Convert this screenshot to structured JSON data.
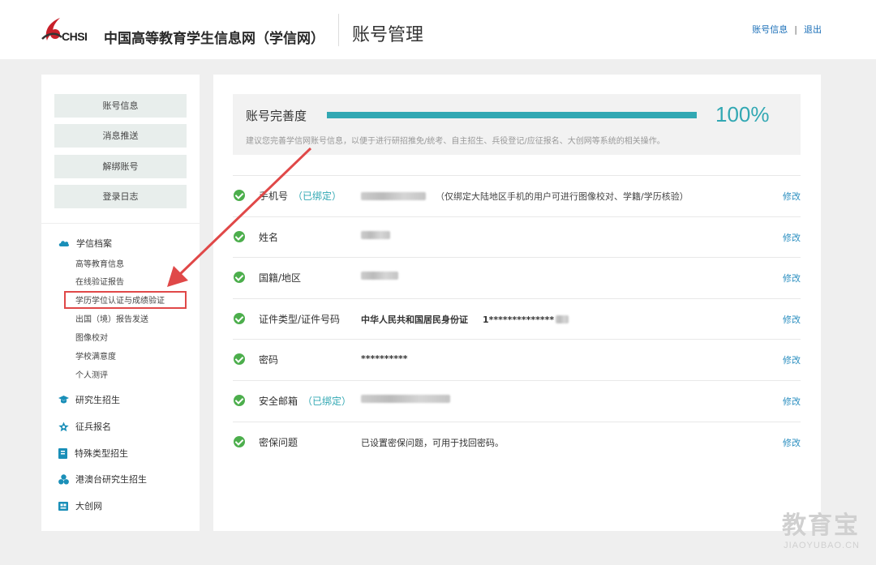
{
  "header": {
    "logo_text": "CHSI",
    "site_name": "中国高等教育学生信息网（学信网）",
    "page_title": "账号管理",
    "links": [
      "账号信息",
      "退出"
    ],
    "link_separator": "|"
  },
  "sidebar": {
    "buttons": [
      "账号信息",
      "消息推送",
      "解绑账号",
      "登录日志"
    ],
    "sections": [
      {
        "title": "学信档案",
        "icon": "cloud-icon",
        "items": [
          "高等教育信息",
          "在线验证报告",
          "学历学位认证与成绩验证",
          "出国（境）报告发送",
          "图像校对",
          "学校满意度",
          "个人测评"
        ]
      },
      {
        "title": "研究生招生",
        "icon": "graduation-cap-icon"
      },
      {
        "title": "征兵报名",
        "icon": "star-icon"
      },
      {
        "title": "特殊类型招生",
        "icon": "book-icon"
      },
      {
        "title": "港澳台研究生招生",
        "icon": "three-circles-icon"
      },
      {
        "title": "大创网",
        "icon": "box-icon"
      }
    ]
  },
  "progress": {
    "label": "账号完善度",
    "percent": 100,
    "percent_text": "100%",
    "tip": "建议您完善学信网账号信息，以便于进行研招推免/统考、自主招生、兵役登记/应征报名、大创网等系统的相关操作。"
  },
  "rows": [
    {
      "label": "手机号",
      "bound": "（已绑定）",
      "note": "（仅绑定大陆地区手机的用户可进行图像校对、学籍/学历核验）",
      "edit": "修改"
    },
    {
      "label": "姓名",
      "edit": "修改"
    },
    {
      "label": "国籍/地区",
      "edit": "修改"
    },
    {
      "label": "证件类型/证件号码",
      "id_type": "中华人民共和国居民身份证",
      "id_number": "1**************",
      "edit": "修改"
    },
    {
      "label": "密码",
      "value": "**********",
      "edit": "修改"
    },
    {
      "label": "安全邮箱",
      "bound": "（已绑定）",
      "edit": "修改"
    },
    {
      "label": "密保问题",
      "value": "已设置密保问题，可用于找回密码。",
      "edit": "修改"
    }
  ],
  "watermark": {
    "cn": "教育宝",
    "en": "JIAOYUBAO.CN"
  },
  "colors": {
    "accent": "#32a8b3",
    "link": "#2b8fc0",
    "check": "#4cae4c",
    "highlight": "#e04848"
  }
}
